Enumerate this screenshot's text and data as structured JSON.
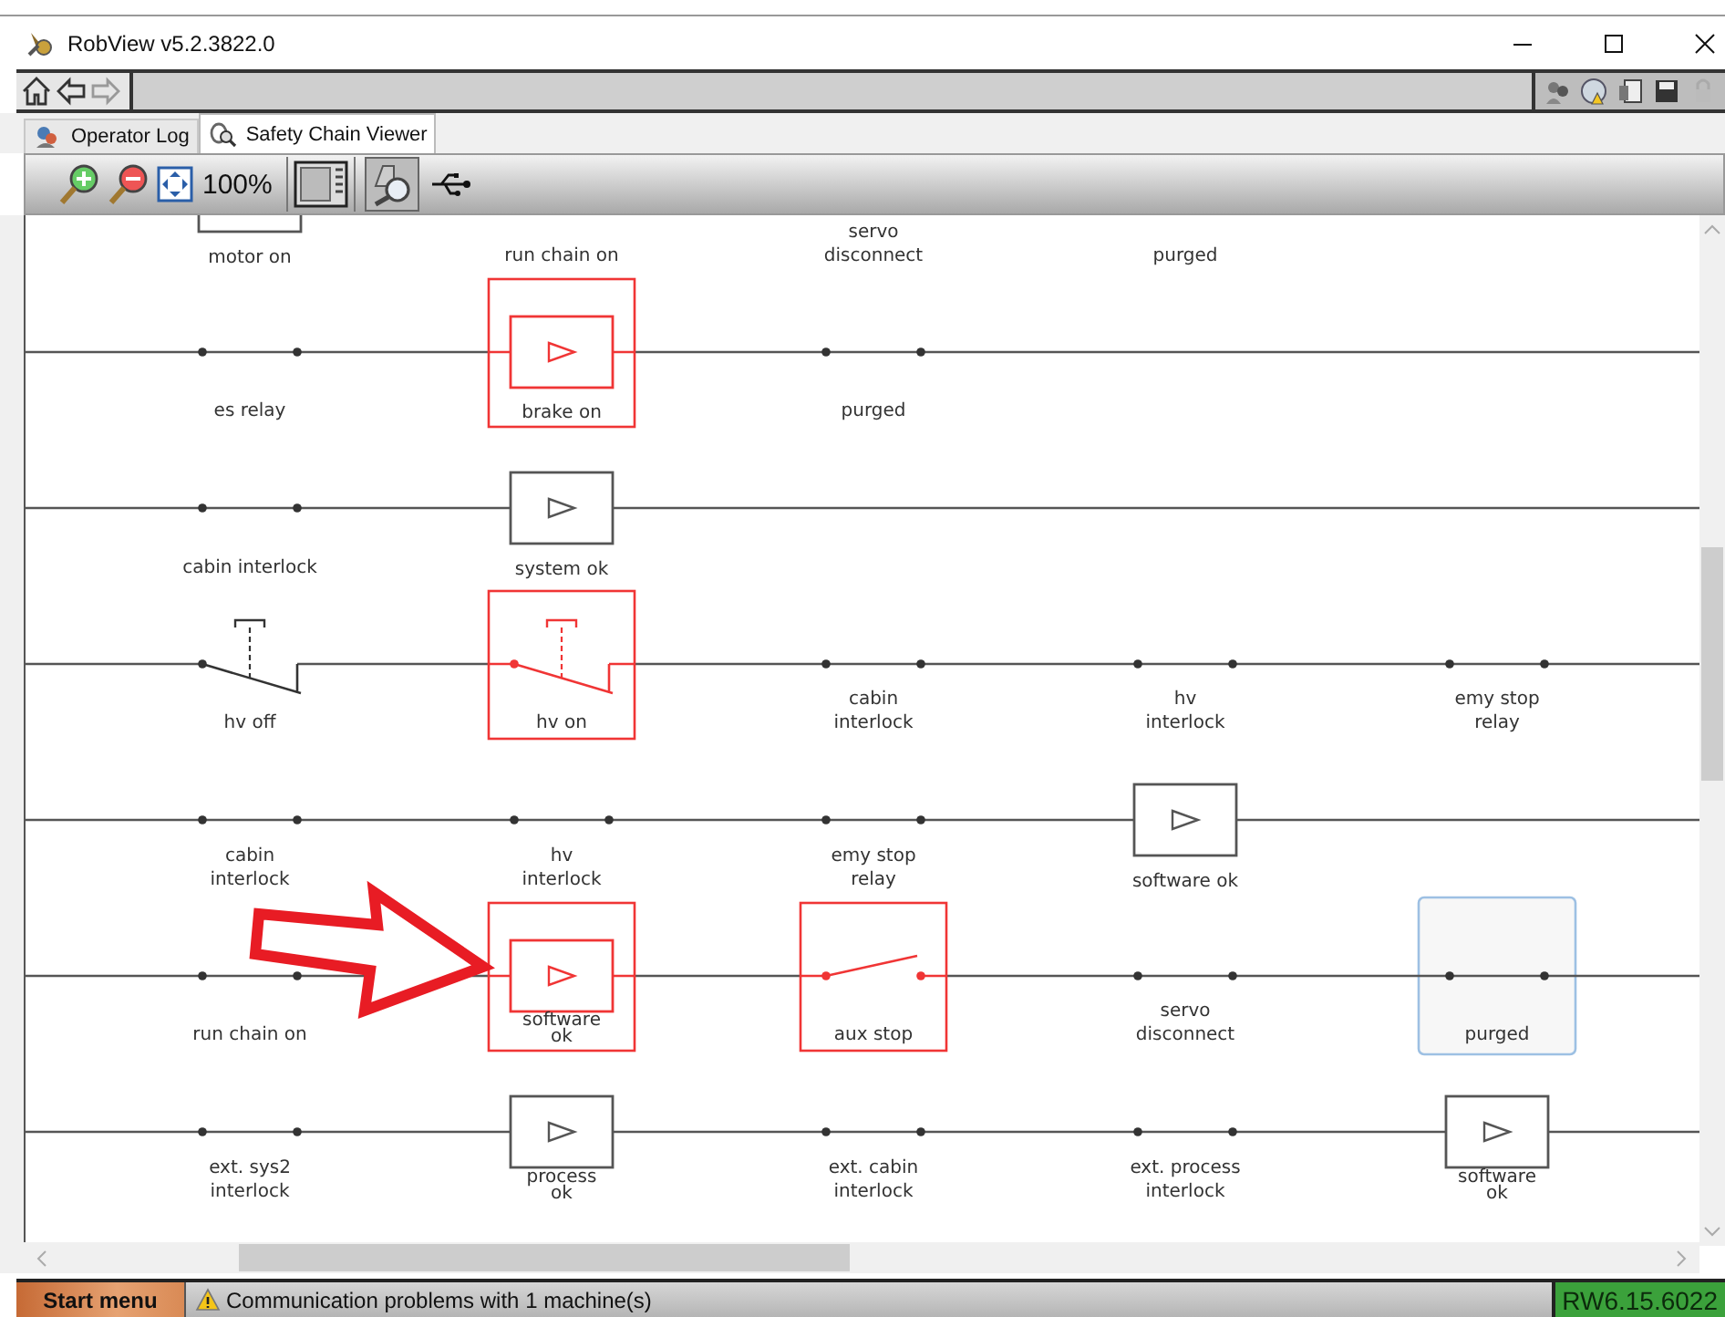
{
  "window": {
    "title": "RobView v5.2.3822.0"
  },
  "tabs": [
    {
      "label": "Operator Log",
      "selected": false
    },
    {
      "label": "Safety Chain Viewer",
      "selected": true
    }
  ],
  "toolbar": {
    "zoom": "100%"
  },
  "diagram": {
    "rungs": [
      {
        "elements": [
          {
            "kind": "coil",
            "label": [
              "motor on"
            ],
            "fault": false,
            "selected": false
          },
          {
            "kind": "label",
            "label": [
              "run chain on"
            ],
            "fault": false,
            "selected": false
          },
          {
            "kind": "label",
            "label": [
              "servo",
              "disconnect"
            ],
            "fault": false,
            "selected": false
          },
          {
            "kind": "label",
            "label": [
              "purged"
            ],
            "fault": false,
            "selected": false
          }
        ]
      },
      {
        "elements": [
          {
            "kind": "contact",
            "label": [
              "es relay"
            ],
            "fault": false,
            "selected": false
          },
          {
            "kind": "coil",
            "label": [
              "brake on"
            ],
            "fault": true,
            "selected": false
          },
          {
            "kind": "contact",
            "label": [
              "purged"
            ],
            "fault": false,
            "selected": false
          }
        ]
      },
      {
        "elements": [
          {
            "kind": "contact",
            "label": [
              "cabin interlock"
            ],
            "fault": false,
            "selected": false
          },
          {
            "kind": "coil",
            "label": [
              "system ok"
            ],
            "fault": false,
            "selected": false
          }
        ]
      },
      {
        "elements": [
          {
            "kind": "nc_contact",
            "label": [
              "hv off"
            ],
            "fault": false,
            "selected": false
          },
          {
            "kind": "nc_contact",
            "label": [
              "hv on"
            ],
            "fault": true,
            "selected": false
          },
          {
            "kind": "contact",
            "label": [
              "cabin",
              "interlock"
            ],
            "fault": false,
            "selected": false
          },
          {
            "kind": "contact",
            "label": [
              "hv",
              "interlock"
            ],
            "fault": false,
            "selected": false
          },
          {
            "kind": "contact",
            "label": [
              "emy stop",
              "relay"
            ],
            "fault": false,
            "selected": false
          }
        ]
      },
      {
        "elements": [
          {
            "kind": "contact",
            "label": [
              "cabin",
              "interlock"
            ],
            "fault": false,
            "selected": false
          },
          {
            "kind": "contact",
            "label": [
              "hv",
              "interlock"
            ],
            "fault": false,
            "selected": false
          },
          {
            "kind": "contact",
            "label": [
              "emy stop",
              "relay"
            ],
            "fault": false,
            "selected": false
          },
          {
            "kind": "coil",
            "label": [
              "software ok"
            ],
            "fault": false,
            "selected": false
          }
        ]
      },
      {
        "elements": [
          {
            "kind": "contact",
            "label": [
              "run chain on"
            ],
            "fault": false,
            "selected": false
          },
          {
            "kind": "coil",
            "label": [
              "software",
              "ok"
            ],
            "fault": true,
            "selected": false
          },
          {
            "kind": "open_switch",
            "label": [
              "aux stop"
            ],
            "fault": true,
            "selected": false
          },
          {
            "kind": "contact",
            "label": [
              "servo",
              "disconnect"
            ],
            "fault": false,
            "selected": false
          },
          {
            "kind": "contact",
            "label": [
              "purged"
            ],
            "fault": false,
            "selected": true
          }
        ]
      },
      {
        "elements": [
          {
            "kind": "contact",
            "label": [
              "ext. sys2",
              "interlock"
            ],
            "fault": false,
            "selected": false
          },
          {
            "kind": "coil",
            "label": [
              "process",
              "ok"
            ],
            "fault": false,
            "selected": false
          },
          {
            "kind": "contact",
            "label": [
              "ext. cabin",
              "interlock"
            ],
            "fault": false,
            "selected": false
          },
          {
            "kind": "contact",
            "label": [
              "ext. process",
              "interlock"
            ],
            "fault": false,
            "selected": false
          },
          {
            "kind": "coil",
            "label": [
              "software",
              "ok"
            ],
            "fault": false,
            "selected": false
          }
        ]
      }
    ]
  },
  "status_bar": {
    "start": "Start menu",
    "message": "Communication problems with 1 machine(s)",
    "version": "RW6.15.6022"
  }
}
